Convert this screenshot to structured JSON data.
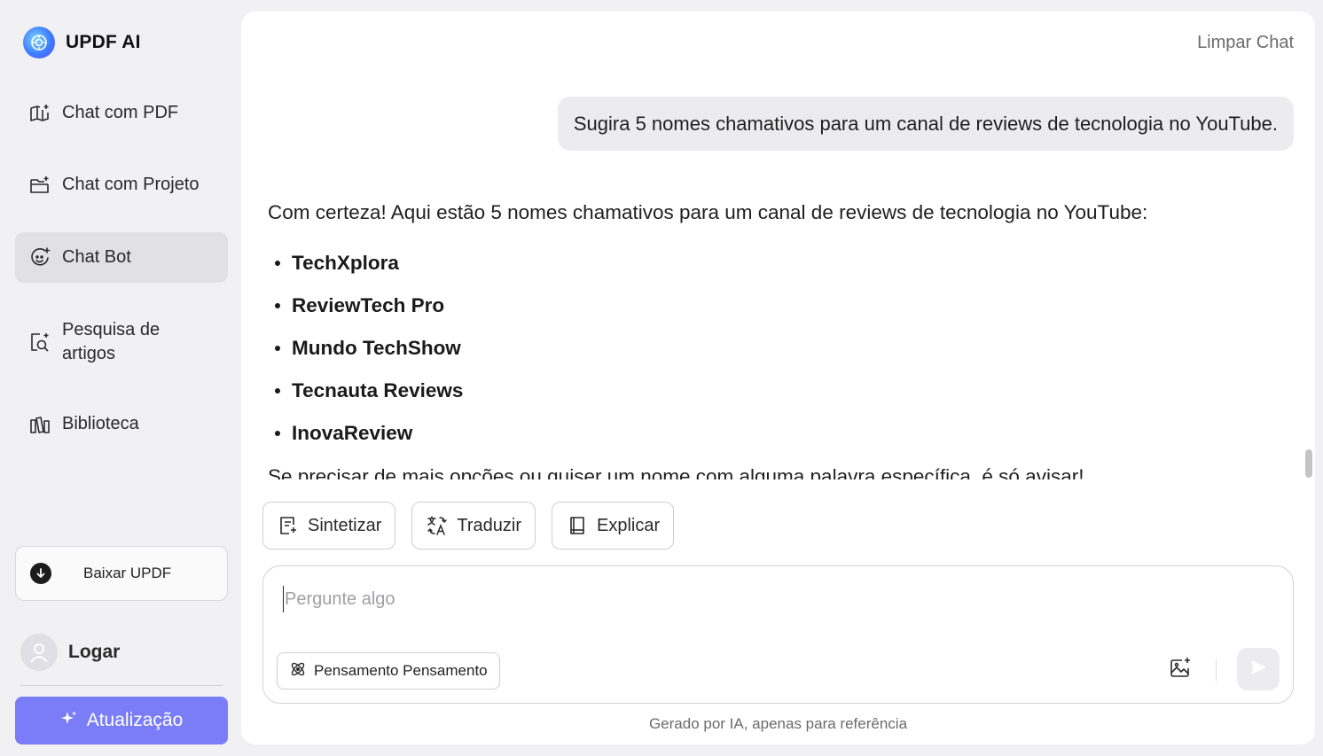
{
  "sidebar": {
    "brand": "UPDF AI",
    "items": [
      {
        "label": "Chat com PDF",
        "icon": "book-sparkle-icon",
        "active": false
      },
      {
        "label": "Chat com Projeto",
        "icon": "folder-sparkle-icon",
        "active": false
      },
      {
        "label": "Chat Bot",
        "icon": "bot-face-icon",
        "active": true
      },
      {
        "label": "Pesquisa de artigos",
        "icon": "document-search-icon",
        "active": false
      },
      {
        "label": "Biblioteca",
        "icon": "library-books-icon",
        "active": false
      }
    ],
    "download_label": "Baixar UPDF",
    "login_label": "Logar",
    "upgrade_label": "Atualização"
  },
  "main": {
    "clear_chat": "Limpar Chat",
    "user_message": "Sugira 5 nomes chamativos para um canal de reviews de tecnologia no YouTube.",
    "assistant": {
      "intro": "Com certeza! Aqui estão 5 nomes chamativos para um canal de reviews de tecnologia no YouTube:",
      "items": [
        "TechXplora",
        "ReviewTech Pro",
        "Mundo TechShow",
        "Tecnauta Reviews",
        "InovaReview"
      ],
      "outro": "Se precisar de mais opções ou quiser um nome com alguma palavra específica, é só avisar!"
    },
    "actions": [
      {
        "label": "Sintetizar",
        "icon": "summarize-icon"
      },
      {
        "label": "Traduzir",
        "icon": "translate-icon"
      },
      {
        "label": "Explicar",
        "icon": "book-icon"
      }
    ],
    "input": {
      "placeholder": "Pergunte algo",
      "value": ""
    },
    "thinking_label": "Pensamento Pensamento",
    "disclaimer": "Gerado por IA, apenas para referência"
  },
  "colors": {
    "accent": "#7a7df7",
    "sidebar_bg": "#f1f1f3",
    "active_item_bg": "#e1e1e4",
    "panel_bg": "#ffffff"
  }
}
